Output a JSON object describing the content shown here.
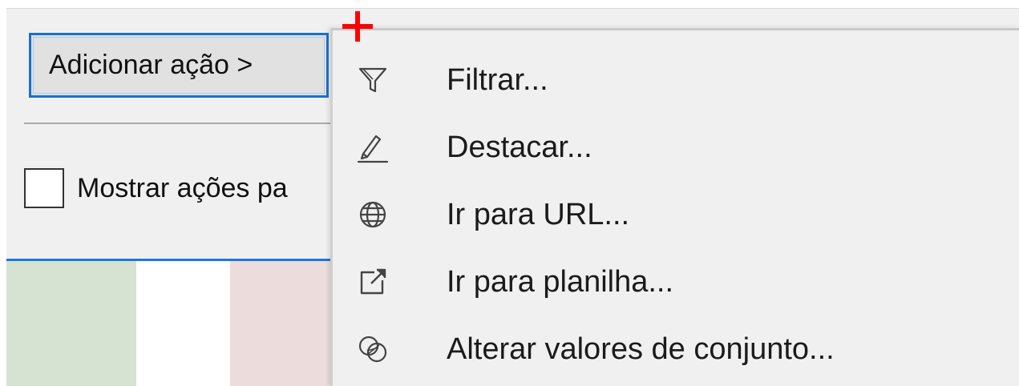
{
  "dialog": {
    "add_action_button": "Adicionar ação >",
    "show_actions_checkbox": {
      "label": "Mostrar ações pa",
      "checked": false
    }
  },
  "menu": {
    "items": [
      {
        "label": "Filtrar...",
        "icon": "filter-icon"
      },
      {
        "label": "Destacar...",
        "icon": "highlighter-icon"
      },
      {
        "label": "Ir para URL...",
        "icon": "globe-icon"
      },
      {
        "label": "Ir para planilha...",
        "icon": "external-link-icon"
      },
      {
        "label": "Alterar valores de conjunto...",
        "icon": "set-values-icon"
      }
    ]
  },
  "colors": {
    "accent": "#1a6fd1",
    "cursor": "#ff0000"
  }
}
